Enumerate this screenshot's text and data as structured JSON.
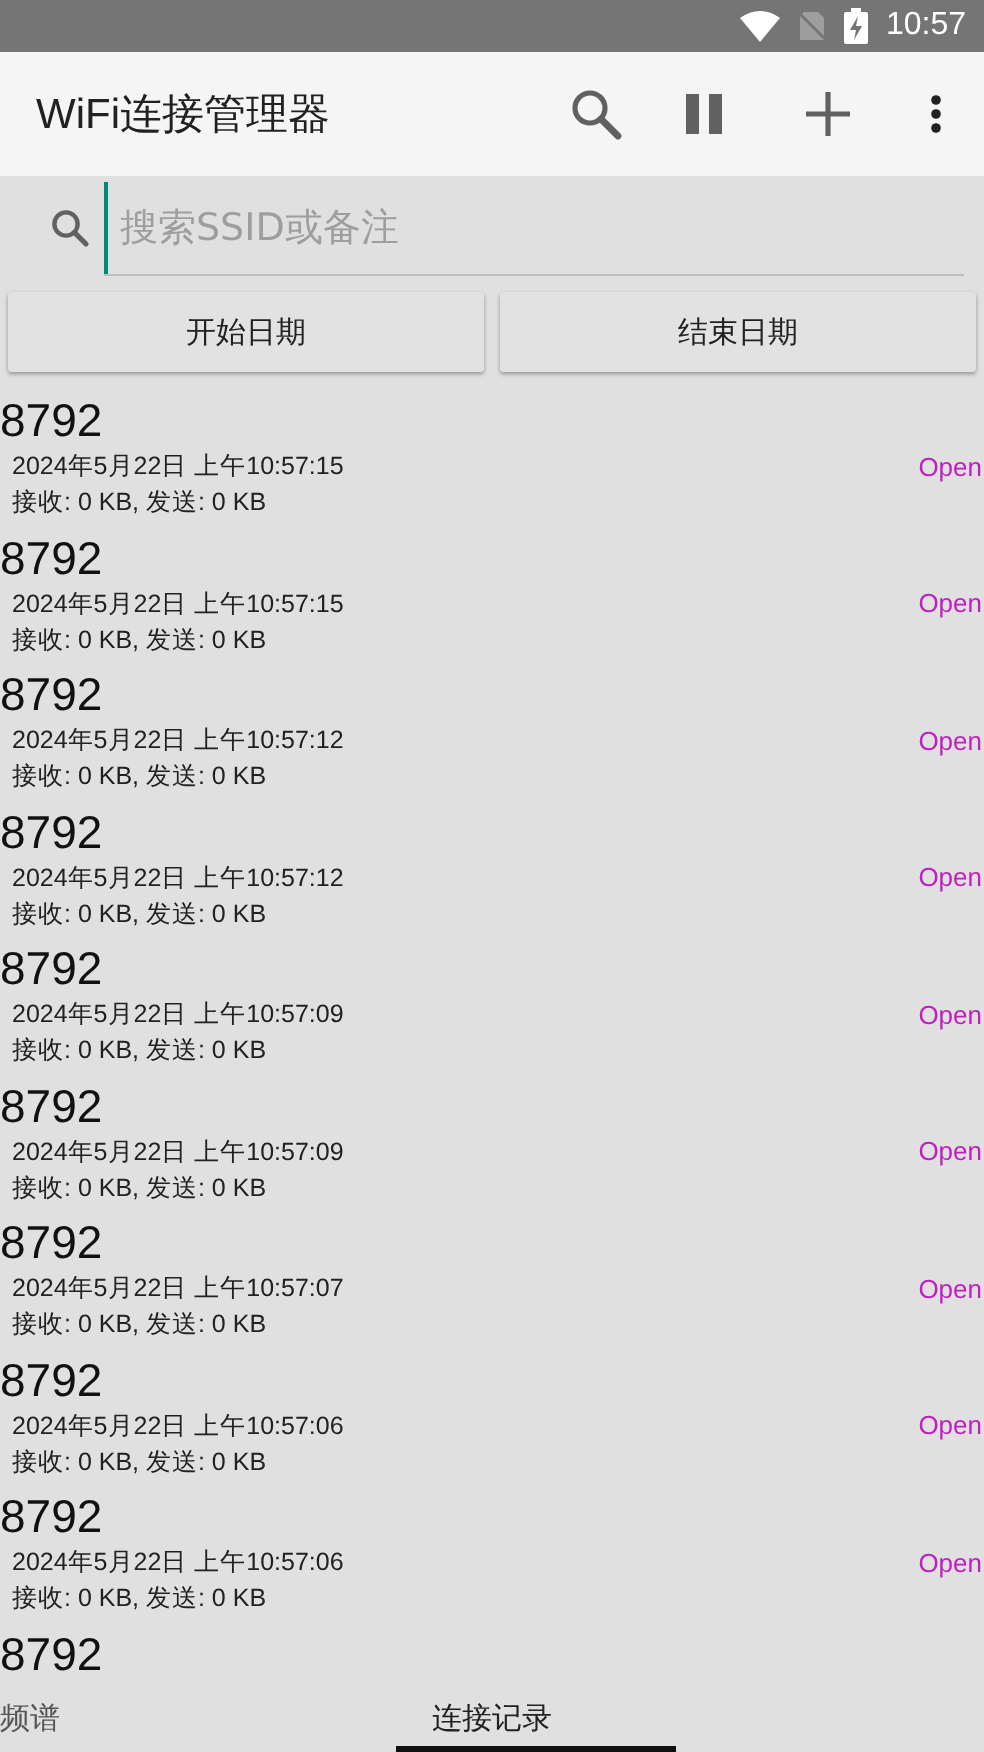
{
  "status_bar": {
    "time": "10:57"
  },
  "app_bar": {
    "title": "WiFi连接管理器"
  },
  "search": {
    "placeholder": "搜索SSID或备注"
  },
  "date_buttons": [
    "开始日期",
    "结束日期"
  ],
  "records": [
    {
      "ssid": "8792",
      "time": "2024年5月22日 上午10:57:15",
      "traffic": "接收: 0 KB, 发送: 0 KB",
      "security": "Open"
    },
    {
      "ssid": "8792",
      "time": "2024年5月22日 上午10:57:15",
      "traffic": "接收: 0 KB, 发送: 0 KB",
      "security": "Open"
    },
    {
      "ssid": "8792",
      "time": "2024年5月22日 上午10:57:12",
      "traffic": "接收: 0 KB, 发送: 0 KB",
      "security": "Open"
    },
    {
      "ssid": "8792",
      "time": "2024年5月22日 上午10:57:12",
      "traffic": "接收: 0 KB, 发送: 0 KB",
      "security": "Open"
    },
    {
      "ssid": "8792",
      "time": "2024年5月22日 上午10:57:09",
      "traffic": "接收: 0 KB, 发送: 0 KB",
      "security": "Open"
    },
    {
      "ssid": "8792",
      "time": "2024年5月22日 上午10:57:09",
      "traffic": "接收: 0 KB, 发送: 0 KB",
      "security": "Open"
    },
    {
      "ssid": "8792",
      "time": "2024年5月22日 上午10:57:07",
      "traffic": "接收: 0 KB, 发送: 0 KB",
      "security": "Open"
    },
    {
      "ssid": "8792",
      "time": "2024年5月22日 上午10:57:06",
      "traffic": "接收: 0 KB, 发送: 0 KB",
      "security": "Open"
    },
    {
      "ssid": "8792",
      "time": "2024年5月22日 上午10:57:06",
      "traffic": "接收: 0 KB, 发送: 0 KB",
      "security": "Open"
    },
    {
      "ssid": "8792"
    }
  ],
  "tabs": [
    {
      "label": "频谱",
      "selected": false
    },
    {
      "label": "连接记录",
      "selected": true
    }
  ]
}
